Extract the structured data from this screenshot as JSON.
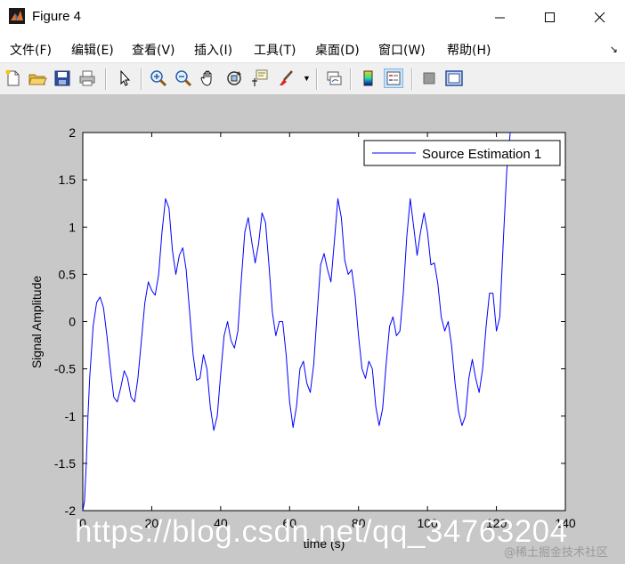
{
  "window": {
    "title": "Figure 4",
    "controls": [
      "minimize",
      "maximize",
      "close"
    ]
  },
  "menubar": {
    "items": [
      {
        "label": "文件(F)"
      },
      {
        "label": "编辑(E)"
      },
      {
        "label": "查看(V)"
      },
      {
        "label": "插入(I)"
      },
      {
        "label": "工具(T)"
      },
      {
        "label": "桌面(D)"
      },
      {
        "label": "窗口(W)"
      },
      {
        "label": "帮助(H)"
      }
    ],
    "overflow_icon": "dock-arrow-icon"
  },
  "toolbar": {
    "buttons": [
      {
        "icon": "new-figure-icon"
      },
      {
        "icon": "open-file-icon"
      },
      {
        "icon": "save-icon"
      },
      {
        "icon": "print-icon"
      },
      {
        "icon": "edit-plot-arrow-icon"
      },
      {
        "icon": "zoom-in-icon"
      },
      {
        "icon": "zoom-out-icon"
      },
      {
        "icon": "pan-hand-icon"
      },
      {
        "icon": "rotate-3d-icon"
      },
      {
        "icon": "data-cursor-icon"
      },
      {
        "icon": "brush-icon"
      },
      {
        "icon": "link-plot-icon"
      },
      {
        "icon": "colorbar-icon"
      },
      {
        "icon": "legend-icon",
        "pressed": true
      },
      {
        "icon": "hide-plot-tools-icon"
      },
      {
        "icon": "show-plot-tools-icon"
      }
    ]
  },
  "chart_data": {
    "type": "line",
    "title": "",
    "xlabel": "time (s)",
    "ylabel": "Signal Amplitude",
    "xlim": [
      0,
      140
    ],
    "ylim": [
      -2,
      2
    ],
    "xticks": [
      0,
      20,
      40,
      60,
      80,
      100,
      120,
      140
    ],
    "yticks": [
      -2,
      -1.5,
      -1,
      -0.5,
      0,
      0.5,
      1,
      1.5,
      2
    ],
    "ytick_labels": [
      "-2",
      "-1.5",
      "-1",
      "-0.5",
      "0",
      "0.5",
      "1",
      "1.5",
      "2"
    ],
    "grid": false,
    "legend": {
      "position": "top-right",
      "entries": [
        "Source Estimation 1"
      ]
    },
    "series": [
      {
        "name": "Source Estimation 1",
        "color": "#0000ff",
        "x": [
          0,
          0.5,
          1,
          1.5,
          2,
          3,
          4,
          5,
          6,
          7,
          8,
          9,
          10,
          11,
          12,
          13,
          14,
          15,
          16,
          17,
          18,
          19,
          20,
          21,
          22,
          23,
          24,
          25,
          26,
          27,
          28,
          29,
          30,
          31,
          32,
          33,
          34,
          35,
          36,
          37,
          38,
          39,
          40,
          41,
          42,
          43,
          44,
          45,
          46,
          47,
          48,
          49,
          50,
          51,
          52,
          53,
          54,
          55,
          56,
          57,
          58,
          59,
          60,
          61,
          62,
          63,
          64,
          65,
          66,
          67,
          68,
          69,
          70,
          71,
          72,
          73,
          74,
          75,
          76,
          77,
          78,
          79,
          80,
          81,
          82,
          83,
          84,
          85,
          86,
          87,
          88,
          89,
          90,
          91,
          92,
          93,
          94,
          95,
          96,
          97,
          98,
          99,
          100,
          101,
          102,
          103,
          104,
          105,
          106,
          107,
          108,
          109,
          110,
          111,
          112,
          113,
          114,
          115,
          116,
          117,
          118,
          119,
          120,
          121,
          122,
          123,
          124,
          125
        ],
        "y": [
          -2.0,
          -1.9,
          -1.5,
          -1.0,
          -0.6,
          -0.05,
          0.2,
          0.26,
          0.15,
          -0.15,
          -0.5,
          -0.8,
          -0.85,
          -0.7,
          -0.52,
          -0.6,
          -0.8,
          -0.85,
          -0.6,
          -0.2,
          0.2,
          0.42,
          0.33,
          0.28,
          0.5,
          0.95,
          1.3,
          1.2,
          0.75,
          0.5,
          0.7,
          0.78,
          0.55,
          0.1,
          -0.35,
          -0.62,
          -0.6,
          -0.35,
          -0.5,
          -0.9,
          -1.15,
          -1.0,
          -0.55,
          -0.15,
          0.0,
          -0.2,
          -0.28,
          -0.1,
          0.45,
          0.95,
          1.1,
          0.85,
          0.62,
          0.82,
          1.15,
          1.05,
          0.6,
          0.1,
          -0.15,
          0.0,
          0.0,
          -0.35,
          -0.85,
          -1.12,
          -0.9,
          -0.5,
          -0.42,
          -0.65,
          -0.75,
          -0.45,
          0.1,
          0.6,
          0.72,
          0.55,
          0.42,
          0.85,
          1.3,
          1.1,
          0.65,
          0.5,
          0.55,
          0.28,
          -0.15,
          -0.5,
          -0.6,
          -0.42,
          -0.5,
          -0.9,
          -1.1,
          -0.92,
          -0.45,
          -0.05,
          0.05,
          -0.15,
          -0.1,
          0.3,
          0.9,
          1.3,
          1.0,
          0.7,
          0.95,
          1.15,
          0.95,
          0.6,
          0.62,
          0.4,
          0.05,
          -0.1,
          0.0,
          -0.25,
          -0.65,
          -0.95,
          -1.1,
          -1.0,
          -0.6,
          -0.4,
          -0.6,
          -0.75,
          -0.5,
          -0.05,
          0.3,
          0.3,
          -0.1,
          0.05,
          0.85,
          1.6,
          2.0,
          2.1
        ]
      }
    ]
  },
  "watermark": {
    "text": "https://blog.csdn.net/qq_34763204",
    "small_text": "@稀土掘金技术社区"
  }
}
